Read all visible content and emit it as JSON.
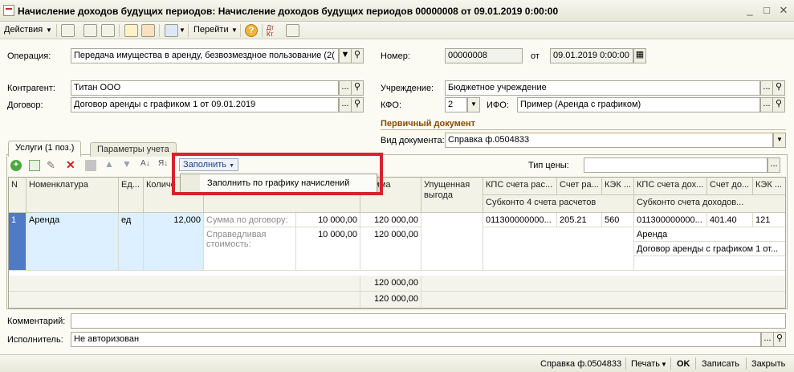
{
  "window": {
    "title": "Начисление доходов будущих периодов: Начисление доходов будущих периодов 00000008 от 09.01.2019 0:00:00",
    "minimize": "_",
    "maximize": "□",
    "close": "✕"
  },
  "toolbar": {
    "actions_label": "Действия",
    "goto_label": "Перейти",
    "help_icon": "?",
    "dt_kt_icon": "Дт Кт"
  },
  "header": {
    "operation_label": "Операция:",
    "operation_value": "Передача имущества в аренду, безвозмездное пользование (2(",
    "number_label": "Номер:",
    "number_value": "00000008",
    "date_prefix": "от",
    "date_value": "09.01.2019  0:00:00",
    "counterparty_label": "Контрагент:",
    "counterparty_value": "Титан ООО",
    "institution_label": "Учреждение:",
    "institution_value": "Бюджетное учреждение",
    "contract_label": "Договор:",
    "contract_value": "Договор аренды с графиком 1 от 09.01.2019",
    "kfo_label": "КФО:",
    "kfo_value": "2",
    "ifo_label": "ИФО:",
    "ifo_value": "Пример (Аренда с графиком)",
    "primary_doc_title": "Первичный документ",
    "doc_type_label": "Вид документа:",
    "doc_type_value": "Справка ф.0504833",
    "ellipsis": "...",
    "search_glyph": "⚲",
    "dropdown_glyph": "▼"
  },
  "tabs": [
    {
      "label": "Услуги (1 поз.)"
    },
    {
      "label": "Параметры учета"
    }
  ],
  "table_toolbar": {
    "fill_button": "Заполнить",
    "price_type_label": "Тип цены:",
    "price_type_value": ""
  },
  "fill_menu": {
    "item_1": "Заполнить по графику начислений"
  },
  "grid": {
    "headers": {
      "n": "N",
      "nomenclature": "Номенклатура",
      "unit": "Ед...",
      "quantity": "Количе",
      "amount": "Сумма",
      "lost_profit": "Упущенная выгода",
      "kps_settlement": "КПС счета рас...",
      "acc_settlement": "Счет ра...",
      "kek1": "КЭК ...",
      "kps_income": "КПС счета дох...",
      "acc_income": "Счет до...",
      "kek2": "КЭК ...",
      "subconto4": "Субконто 4 счета расчетов",
      "subconto_income": "Субконто счета доходов..."
    },
    "row": {
      "n": "1",
      "nomenclature": "Аренда",
      "unit": "ед",
      "quantity": "12,000",
      "sum_contract_label": "Сумма по договору:",
      "sum_contract_value": "10 000,00",
      "sum_contract_total": "120 000,00",
      "fair_value_label": "Справедливая стоимость:",
      "fair_value_value": "10 000,00",
      "fair_value_total": "120 000,00",
      "kps_settlement": "011300000000...",
      "acc_settlement": "205.21",
      "kek1": "560",
      "kps_income": "011300000000...",
      "acc_income": "401.40",
      "kek2": "121",
      "subconto_income_1": "Аренда",
      "subconto_income_2": "Договор аренды с графиком 1 от..."
    },
    "totals": {
      "total_1": "120 000,00",
      "total_2": "120 000,00"
    }
  },
  "footer": {
    "comment_label": "Комментарий:",
    "comment_value": "",
    "executor_label": "Исполнитель:",
    "executor_value": "Не авторизован"
  },
  "statusbar": {
    "report": "Справка ф.0504833",
    "print": "Печать",
    "ok": "OK",
    "save": "Записать",
    "close": "Закрыть"
  }
}
